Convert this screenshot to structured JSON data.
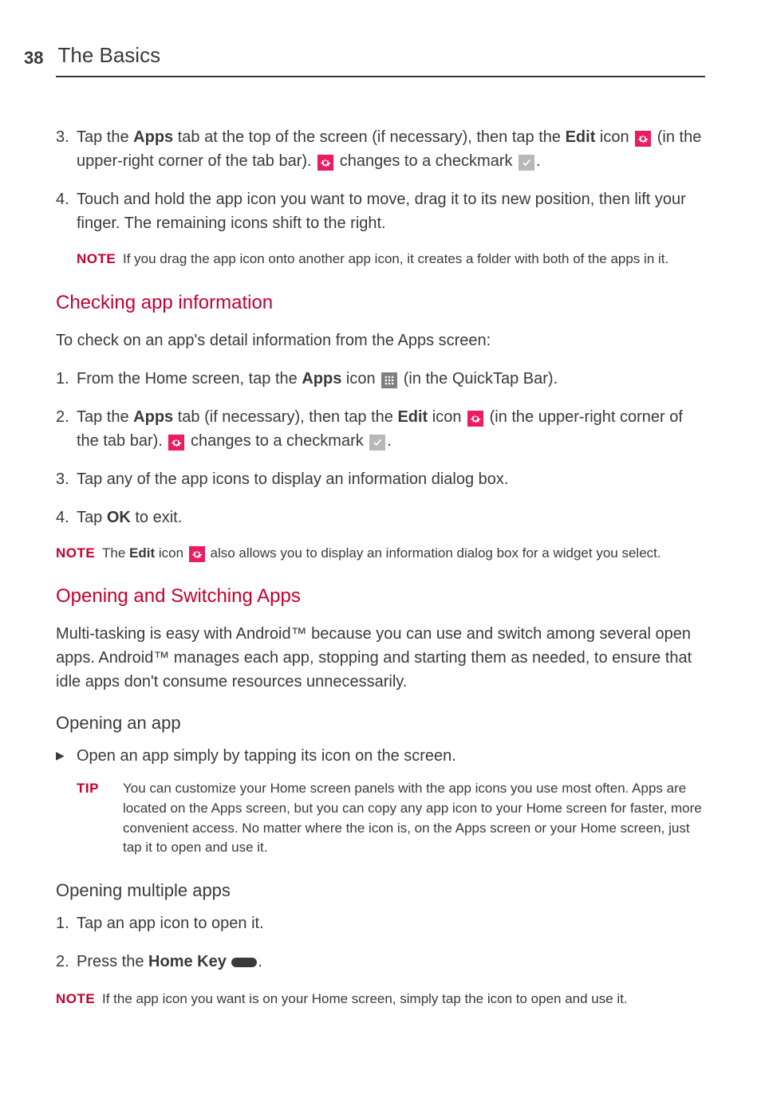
{
  "header": {
    "page_number": "38",
    "section_title": "The Basics"
  },
  "step3": {
    "num": "3.",
    "pre": "Tap the ",
    "apps": "Apps",
    "mid1": " tab at the top of the screen (if necessary), then tap the ",
    "edit": "Edit",
    "mid2": " icon ",
    "mid3": " (in the upper-right corner of the tab bar). ",
    "mid4": " changes to a checkmark ",
    "end": "."
  },
  "step4": {
    "num": "4.",
    "text": "Touch and hold the app icon you want to move, drag it to its new position, then lift your finger. The remaining icons shift to the right."
  },
  "note1": {
    "label": "NOTE",
    "text": "If you drag the app icon onto another app icon, it creates a folder with both of the apps in it."
  },
  "h_check": "Checking app information",
  "check_intro": "To check on an app's detail information from the Apps screen:",
  "c1": {
    "num": "1.",
    "pre": "From the Home screen, tap the ",
    "apps": "Apps",
    "mid": " icon ",
    "end": " (in the QuickTap Bar)."
  },
  "c2": {
    "num": "2.",
    "pre": "Tap the ",
    "apps": "Apps",
    "mid1": " tab (if necessary), then tap the ",
    "edit": "Edit",
    "mid2": " icon ",
    "mid3": " (in the upper-right corner of the tab bar). ",
    "mid4": " changes to a checkmark ",
    "end": "."
  },
  "c3": {
    "num": "3.",
    "text": "Tap any of the app icons to display an information dialog box."
  },
  "c4": {
    "num": "4.",
    "pre": "Tap ",
    "ok": "OK",
    "end": " to exit."
  },
  "note2": {
    "label": "NOTE",
    "pre": "The ",
    "edit": "Edit",
    "mid": " icon ",
    "end": " also allows you to display an information dialog box for a widget you select."
  },
  "h_open": "Opening and Switching Apps",
  "open_para": "Multi-tasking is easy with Android™ because you can use and switch among several open apps. Android™ manages each app, stopping and starting them as needed, to ensure that idle apps don't consume resources unnecessarily.",
  "h_open_app": "Opening an app",
  "bullet1": "Open an app simply by tapping its icon on the screen.",
  "tip1": {
    "label": "TIP",
    "text": "You can customize your Home screen panels with the app icons you use most often. Apps are located on the Apps screen, but you can copy any app icon to your Home screen for faster, more convenient access. No matter where the icon is, on the Apps screen or your Home screen, just tap it to open and use it."
  },
  "h_multi": "Opening multiple apps",
  "m1": {
    "num": "1.",
    "text": "Tap an app icon to open it."
  },
  "m2": {
    "num": "2.",
    "pre": "Press the ",
    "home": "Home Key",
    "end": "."
  },
  "note3": {
    "label": "NOTE",
    "text": "If the app icon you want is on your Home screen, simply tap the icon to open and use it."
  }
}
